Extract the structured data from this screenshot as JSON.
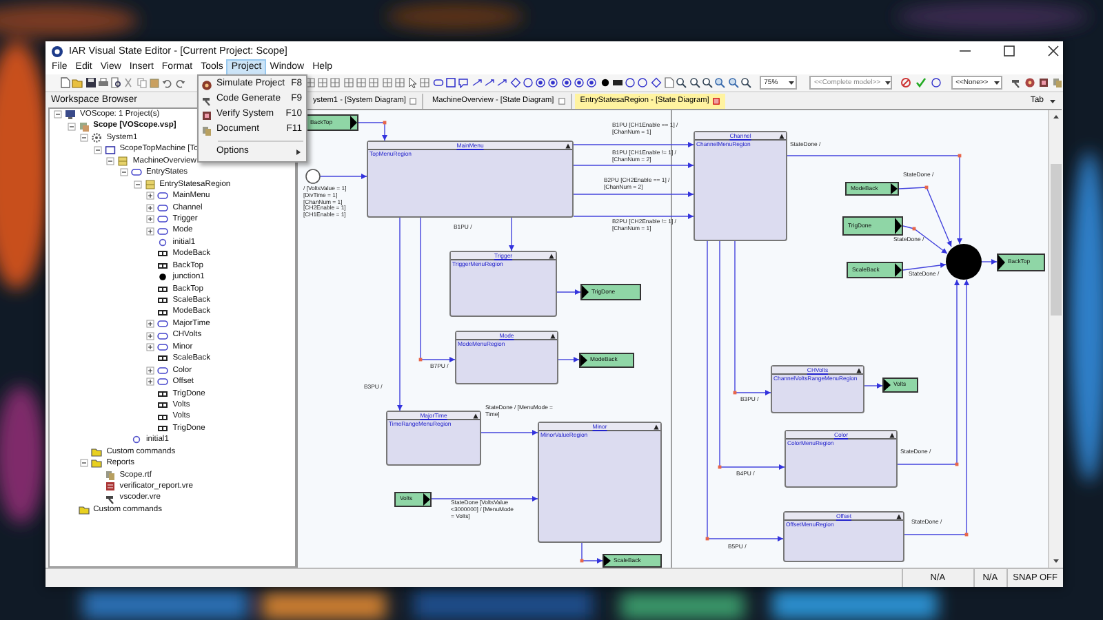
{
  "window": {
    "title": "IAR Visual State Editor - [Current Project: Scope]"
  },
  "menu_bar": [
    {
      "label": "File",
      "selected": false
    },
    {
      "label": "Edit",
      "selected": false
    },
    {
      "label": "View",
      "selected": false
    },
    {
      "label": "Insert",
      "selected": false
    },
    {
      "label": "Format",
      "selected": false
    },
    {
      "label": "Tools",
      "selected": false
    },
    {
      "label": "Project",
      "selected": true
    },
    {
      "label": "Window",
      "selected": false
    },
    {
      "label": "Help",
      "selected": false
    }
  ],
  "project_menu": [
    {
      "label": "Simulate Project",
      "shortcut": "F8",
      "kind": "simulate"
    },
    {
      "label": "Code Generate",
      "shortcut": "F9",
      "kind": "generate"
    },
    {
      "label": "Verify System",
      "shortcut": "F10",
      "kind": "verify"
    },
    {
      "label": "Document",
      "shortcut": "F11",
      "kind": "document"
    },
    {
      "label": "Options",
      "kind": "submenu"
    }
  ],
  "toolbar": {
    "zoom": "75%",
    "model": "<<Complete model>>",
    "filter": "<<None>>"
  },
  "workspace": {
    "title": "Workspace Browser",
    "tree": [
      {
        "label": "VOScope: 1 Project(s)",
        "kind": "workspace",
        "expanded": true,
        "children": [
          {
            "label": "Scope [VOScope.vsp]",
            "kind": "project",
            "expanded": true,
            "children": [
              {
                "label": "System1",
                "kind": "system",
                "expanded": true,
                "children": [
                  {
                    "label": "ScopeTopMachine [To",
                    "kind": "machine",
                    "expanded": true,
                    "children": [
                      {
                        "label": "MachineOverview",
                        "kind": "region",
                        "expanded": true,
                        "children": [
                          {
                            "label": "EntryStates",
                            "kind": "state",
                            "expanded": true,
                            "children": [
                              {
                                "label": "EntryStatesaRegion",
                                "kind": "region",
                                "expanded": true,
                                "children": [
                                  {
                                    "label": "MainMenu",
                                    "kind": "state",
                                    "expanded": false
                                  },
                                  {
                                    "label": "Channel",
                                    "kind": "state",
                                    "expanded": false
                                  },
                                  {
                                    "label": "Trigger",
                                    "kind": "state",
                                    "expanded": false
                                  },
                                  {
                                    "label": "Mode",
                                    "kind": "state",
                                    "expanded": false
                                  },
                                  {
                                    "label": "initial1",
                                    "kind": "initial"
                                  },
                                  {
                                    "label": "ModeBack",
                                    "kind": "connector"
                                  },
                                  {
                                    "label": "BackTop",
                                    "kind": "connector"
                                  },
                                  {
                                    "label": "junction1",
                                    "kind": "junction"
                                  },
                                  {
                                    "label": "BackTop",
                                    "kind": "connector"
                                  },
                                  {
                                    "label": "ScaleBack",
                                    "kind": "connector"
                                  },
                                  {
                                    "label": "ModeBack",
                                    "kind": "connector"
                                  },
                                  {
                                    "label": "MajorTime",
                                    "kind": "state",
                                    "expanded": false
                                  },
                                  {
                                    "label": "CHVolts",
                                    "kind": "state",
                                    "expanded": false
                                  },
                                  {
                                    "label": "Minor",
                                    "kind": "state",
                                    "expanded": false
                                  },
                                  {
                                    "label": "ScaleBack",
                                    "kind": "connector"
                                  },
                                  {
                                    "label": "Color",
                                    "kind": "state",
                                    "expanded": false
                                  },
                                  {
                                    "label": "Offset",
                                    "kind": "state",
                                    "expanded": false
                                  },
                                  {
                                    "label": "TrigDone",
                                    "kind": "connector"
                                  },
                                  {
                                    "label": "Volts",
                                    "kind": "connector"
                                  },
                                  {
                                    "label": "Volts",
                                    "kind": "connector"
                                  },
                                  {
                                    "label": "TrigDone",
                                    "kind": "connector"
                                  }
                                ]
                              }
                            ]
                          },
                          {
                            "label": "initial1",
                            "kind": "initial"
                          }
                        ]
                      }
                    ]
                  }
                ]
              },
              {
                "label": "Custom commands",
                "kind": "folder"
              },
              {
                "label": "Reports",
                "kind": "folder",
                "expanded": true,
                "children": [
                  {
                    "label": "Scope.rtf",
                    "kind": "rtf"
                  },
                  {
                    "label": "verificator_report.vre",
                    "kind": "report"
                  },
                  {
                    "label": "vscoder.vre",
                    "kind": "coder"
                  }
                ]
              }
            ]
          },
          {
            "label": "Custom commands",
            "kind": "folder"
          }
        ]
      }
    ]
  },
  "tabs": [
    {
      "label": "ystem1 - [System Diagram]",
      "selected": false
    },
    {
      "label": "MachineOverview - [State Diagram]",
      "selected": false
    },
    {
      "label": "EntryStatesaRegion - [State Diagram]",
      "selected": true
    }
  ],
  "tab_list": "Tab",
  "diagram": {
    "states": [
      {
        "name": "MainMenu",
        "region": "TopMenuRegion"
      },
      {
        "name": "Channel",
        "region": "ChannelMenuRegion"
      },
      {
        "name": "Trigger",
        "region": "TriggerMenuRegion"
      },
      {
        "name": "Mode",
        "region": "ModeMenuRegion"
      },
      {
        "name": "MajorTime",
        "region": "TimeRangeMenuRegion"
      },
      {
        "name": "Minor",
        "region": "MinorValueRegion"
      },
      {
        "name": "CHVolts",
        "region": "ChannelVoltsRangeMenuRegion"
      },
      {
        "name": "Color",
        "region": "ColorMenuRegion"
      },
      {
        "name": "Offset",
        "region": "OffsetMenuRegion"
      }
    ],
    "connectors": [
      {
        "label": "BackTop"
      },
      {
        "label": "TrigDone"
      },
      {
        "label": "ModeBack"
      },
      {
        "label": "Volts"
      },
      {
        "label": "ScaleBack"
      },
      {
        "label": "ModeBack"
      },
      {
        "label": "TrigDone"
      },
      {
        "label": "ScaleBack"
      },
      {
        "label": "BackTop"
      },
      {
        "label": "Volts"
      }
    ],
    "initial_action": [
      "/ [VoltsValue = 1]",
      "[DivTime = 1]",
      "[ChanNum = 1]",
      "[CH2Enable = 1]",
      "[CH1Enable = 1]"
    ],
    "transition_labels": [
      "B1PU [CH1Enable == 1] / [ChanNum = 1]",
      "B1PU [CH1Enable != 1] / [ChanNum = 2]",
      "B2PU [CH2Enable == 1] / [ChanNum = 2]",
      "B2PU [CH2Enable != 1] / [ChanNum = 1]",
      "StateDone /",
      "B1PU /",
      "B7PU /",
      "B3PU /",
      "StateDone / [MenuMode = Time]",
      "StateDone [VoltsValue <3000000] / [MenuMode = Volts]",
      "StateDone /",
      "StateDone /",
      "StateDone /",
      "B3PU /",
      "StateDone /",
      "B4PU /",
      "StateDone /",
      "B5PU /"
    ]
  },
  "status_bar": [
    "N/A",
    "N/A",
    "SNAP OFF"
  ]
}
